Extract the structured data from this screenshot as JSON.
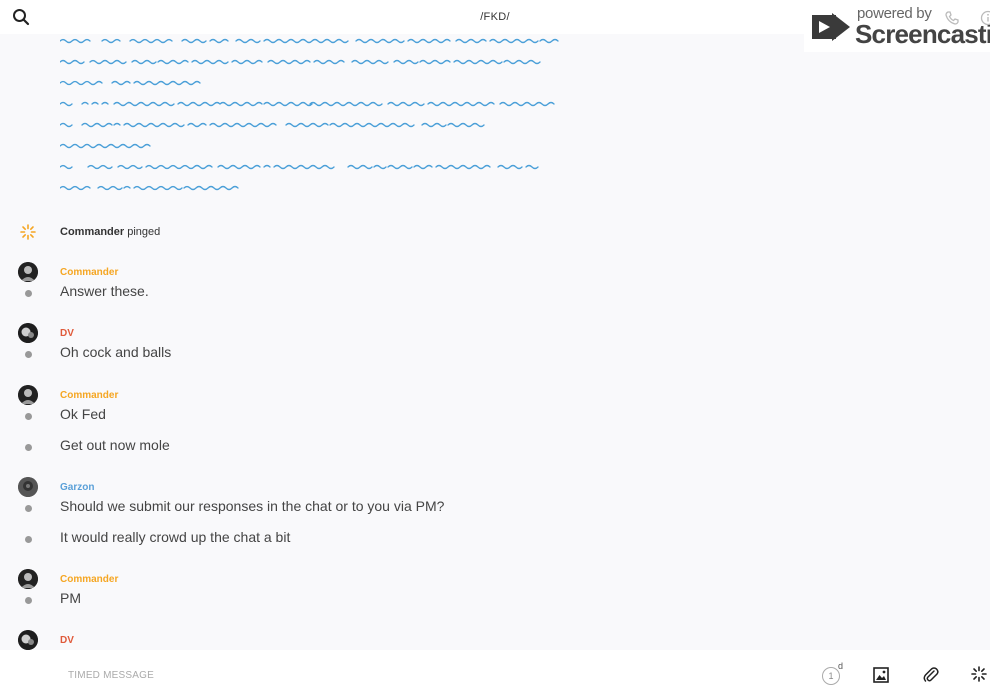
{
  "header": {
    "channel_title": "/FKD/",
    "icons": [
      "search-icon",
      "phone-icon",
      "info-icon"
    ]
  },
  "watermark": {
    "powered": "powered by",
    "brand": "Screencastify"
  },
  "ping": {
    "author": "Commander",
    "action": "pinged",
    "icon": "ping-burst-icon",
    "color": "#f5a623"
  },
  "messages": [
    {
      "author": "Commander",
      "color": "#f5a623",
      "lines": [
        "Answer these."
      ]
    },
    {
      "author": "DV",
      "color": "#e05a3a",
      "lines": [
        "Oh cock and balls"
      ]
    },
    {
      "author": "Commander",
      "color": "#f5a623",
      "lines": [
        "Ok Fed",
        "Get out now mole"
      ]
    },
    {
      "author": "Garzon",
      "color": "#5aa0d8",
      "lines": [
        "Should we submit our responses in the chat or to you via PM?",
        "It would really crowd up the chat a bit"
      ]
    },
    {
      "author": "Commander",
      "color": "#f5a623",
      "lines": [
        "PM"
      ]
    },
    {
      "author": "DV",
      "color": "#e05a3a",
      "lines": []
    }
  ],
  "composer": {
    "placeholder": "TIMED MESSAGE",
    "timer_value": "1",
    "timer_unit": "d",
    "icons": [
      "timer-icon",
      "image-icon",
      "attachment-icon",
      "ping-button-icon"
    ]
  },
  "colors": {
    "scribble": "#4a9fd8",
    "accent_orange": "#f5a623"
  }
}
